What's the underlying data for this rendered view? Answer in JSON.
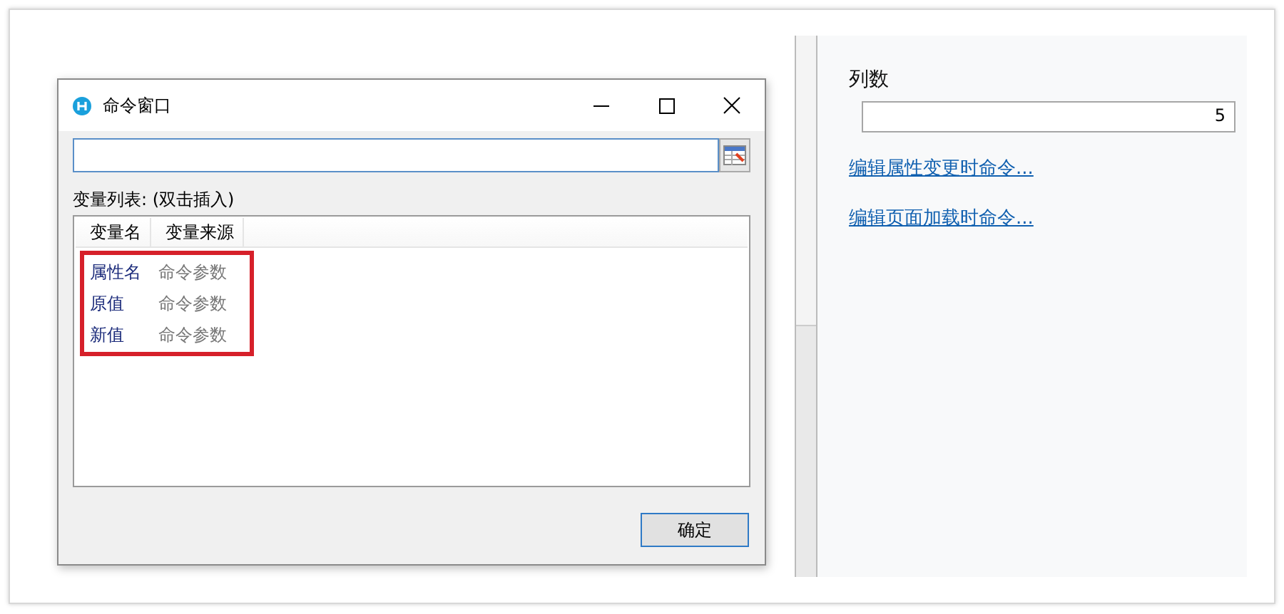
{
  "dialog": {
    "title": "命令窗口",
    "variables_label": "变量列表: (双击插入)",
    "table": {
      "columns": [
        "变量名",
        "变量来源"
      ],
      "highlighted": true,
      "rows": [
        {
          "name": "属性名",
          "source": "命令参数"
        },
        {
          "name": "原值",
          "source": "命令参数"
        },
        {
          "name": "新值",
          "source": "命令参数"
        }
      ]
    },
    "ok_button": "确定"
  },
  "panel": {
    "field_label": "列数",
    "field_value": "5",
    "links": [
      "编辑属性变更时命令...",
      "编辑页面加载时命令..."
    ]
  }
}
